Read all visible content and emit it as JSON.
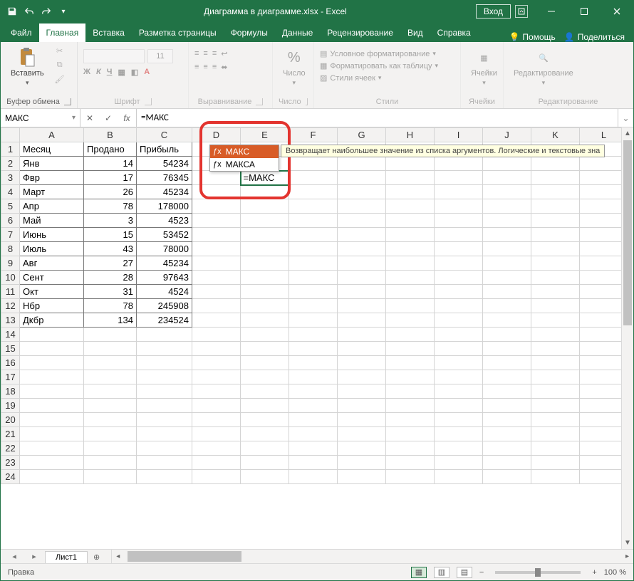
{
  "titlebar": {
    "doc_title": "Диаграмма в диаграмме.xlsx - Excel",
    "signin": "Вход"
  },
  "tabs": {
    "file": "Файл",
    "home": "Главная",
    "insert": "Вставка",
    "pagelayout": "Разметка страницы",
    "formulas": "Формулы",
    "data": "Данные",
    "review": "Рецензирование",
    "view": "Вид",
    "help": "Справка",
    "tellme": "Помощь",
    "share": "Поделиться"
  },
  "ribbon": {
    "clipboard": {
      "paste": "Вставить",
      "group": "Буфер обмена"
    },
    "font": {
      "group": "Шрифт",
      "size": "11"
    },
    "alignment": {
      "group": "Выравнивание"
    },
    "number": {
      "label": "Число",
      "group": "Число"
    },
    "styles": {
      "cond": "Условное форматирование",
      "table": "Форматировать как таблицу",
      "cell": "Стили ячеек",
      "group": "Стили"
    },
    "cells": {
      "label": "Ячейки",
      "group": "Ячейки"
    },
    "editing": {
      "label": "Редактирование",
      "group": "Редактирование"
    }
  },
  "formulabar": {
    "namebox": "МАКС",
    "formula": "=МАКС"
  },
  "autocomplete": {
    "items": [
      "МАКС",
      "МАКСА"
    ],
    "desc": "Возвращает наибольшее значение из списка аргументов. Логические и текстовые зна"
  },
  "columns": [
    "A",
    "B",
    "C",
    "D",
    "E",
    "F",
    "G",
    "H",
    "I",
    "J",
    "K",
    "L"
  ],
  "headers": {
    "a": "Месяц",
    "b": "Продано",
    "c": "Прибыль"
  },
  "rows": [
    {
      "n": 1,
      "a": "Месяц",
      "b": "Продано",
      "c": "Прибыль"
    },
    {
      "n": 2,
      "a": "Янв",
      "b": "14",
      "c": "54234"
    },
    {
      "n": 3,
      "a": "Фвр",
      "b": "17",
      "c": "76345"
    },
    {
      "n": 4,
      "a": "Март",
      "b": "26",
      "c": "45234"
    },
    {
      "n": 5,
      "a": "Апр",
      "b": "78",
      "c": "178000"
    },
    {
      "n": 6,
      "a": "Май",
      "b": "3",
      "c": "4523"
    },
    {
      "n": 7,
      "a": "Июнь",
      "b": "15",
      "c": "53452"
    },
    {
      "n": 8,
      "a": "Июль",
      "b": "43",
      "c": "78000"
    },
    {
      "n": 9,
      "a": "Авг",
      "b": "27",
      "c": "45234"
    },
    {
      "n": 10,
      "a": "Сент",
      "b": "28",
      "c": "97643"
    },
    {
      "n": 11,
      "a": "Окт",
      "b": "31",
      "c": "4524"
    },
    {
      "n": 12,
      "a": "Нбр",
      "b": "78",
      "c": "245908"
    },
    {
      "n": 13,
      "a": "Дкбр",
      "b": "134",
      "c": "234524"
    }
  ],
  "active_cell_text": "=МАКС",
  "sheet": {
    "name": "Лист1"
  },
  "status": {
    "mode": "Правка",
    "zoom": "100 %"
  }
}
